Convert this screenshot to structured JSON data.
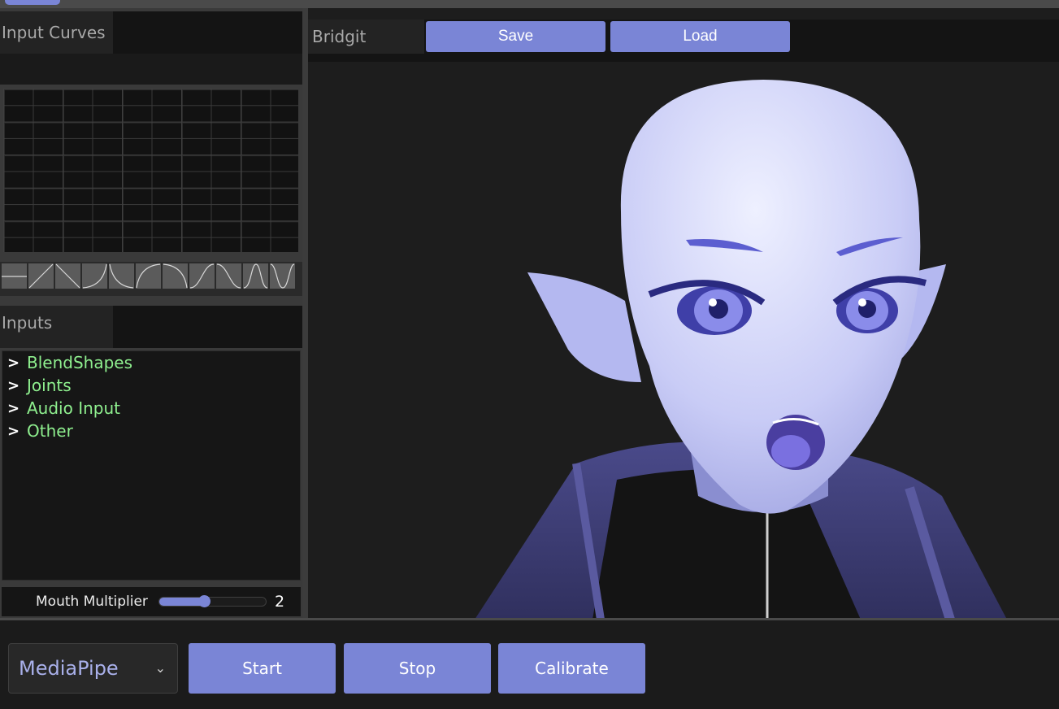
{
  "curves_panel": {
    "title": "Input Curves"
  },
  "curve_presets": [
    "flat-curve-icon",
    "linear-up-curve-icon",
    "linear-down-curve-icon",
    "ease-in-up-curve-icon",
    "ease-in-down-curve-icon",
    "ease-out-up-curve-icon",
    "ease-out-down-curve-icon",
    "s-curve-up-icon",
    "s-curve-down-icon",
    "bell-curve-icon",
    "valley-curve-icon"
  ],
  "inputs_panel": {
    "title": "Inputs",
    "items": [
      {
        "arrow": ">",
        "label": "BlendShapes"
      },
      {
        "arrow": ">",
        "label": "Joints"
      },
      {
        "arrow": ">",
        "label": "Audio Input"
      },
      {
        "arrow": ">",
        "label": "Other"
      }
    ]
  },
  "mouth_multiplier": {
    "label": "Mouth Multiplier",
    "value": "2",
    "fill_fraction": 0.42
  },
  "viewport": {
    "title": "Bridgit",
    "save_label": "Save",
    "load_label": "Load"
  },
  "bottom_bar": {
    "tracker_select": "MediaPipe",
    "start_label": "Start",
    "stop_label": "Stop",
    "calibrate_label": "Calibrate"
  },
  "colors": {
    "accent": "#7a85d6",
    "tree_label": "#8ff08f",
    "panel_bg": "#1c1c1c"
  }
}
